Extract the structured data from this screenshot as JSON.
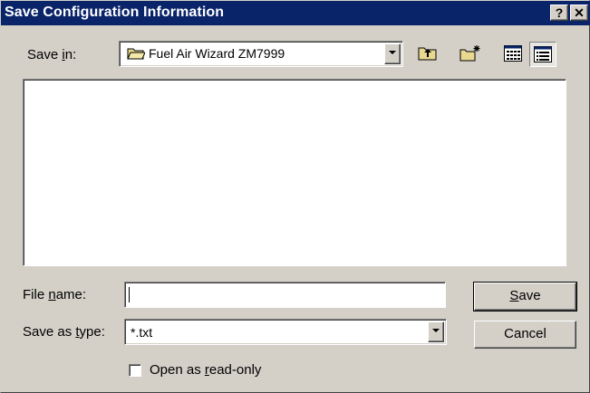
{
  "title_bar": {
    "title": "Save Configuration Information",
    "help_label": "?",
    "close_label": "✕"
  },
  "save_in": {
    "label_pre": "Save ",
    "label_key": "i",
    "label_post": "n:",
    "value": "Fuel Air Wizard ZM7999"
  },
  "toolbar": {
    "up_icon": "up-folder-icon",
    "new_folder_icon": "new-folder-icon",
    "list_view_icon": "list-view-icon",
    "details_view_icon": "details-view-icon"
  },
  "file_name": {
    "label_pre": "File ",
    "label_key": "n",
    "label_post": "ame:",
    "value": ""
  },
  "save_as_type": {
    "label_pre": "Save as ",
    "label_key": "t",
    "label_post": "ype:",
    "value": "*.txt"
  },
  "buttons": {
    "save_key": "S",
    "save_rest": "ave",
    "cancel": "Cancel"
  },
  "read_only": {
    "label_pre": "Open as ",
    "label_key": "r",
    "label_post": "ead-only",
    "checked": false
  }
}
